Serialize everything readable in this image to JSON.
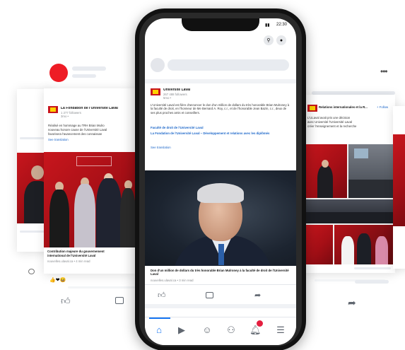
{
  "left_post": {
    "page_name": "La Fondation de l'Université Laval",
    "followers": "1 277 followers",
    "time": "3mo • ",
    "body_line1": "Réalisé en hommage au TRH Brian Mulro",
    "body_line2": "nouveau honore cause de l'Université Laval",
    "body_line3": "favorisera l'avancement des connaissan",
    "see_translation": "See translation",
    "caption_line1": "Contribution majeure du gouvernement",
    "caption_line2": "international de l'Université Laval",
    "caption_meta": "nouvelles.ulaval.ca • 4 min read",
    "reactions": "👍❤😆"
  },
  "right_post": {
    "page_name": "Relations internationales et la R...",
    "follow_label": "+ Follow",
    "body_line1": "L'ULaval avait pris une décision",
    "body_line2": "avec Université l'Université Laval",
    "body_line3": "créer l'enseignement et la recherche"
  },
  "phone": {
    "status_time": "22:30",
    "post": {
      "page_name": "Université Laval",
      "followers": "267 488 followers",
      "time": "5mo • ",
      "body": "L'Université Laval est fière d'annoncer le don d'un million de dollars du très honorable Brian Mulroney à la faculté de droit, en l'honneur de Me Bernard A. Roy, c.r., et de l'honorable Jean Bazin, c.r., deux de ses plus proches amis et conseillers.",
      "link1": "Faculté de droit de l'Université Laval",
      "link2": "La Fondation de l'Université Laval – Développement et relations avec les diplômés",
      "see_translation": "See translation",
      "caption": "Don d'un million de dollars du très honorable Brian Mulroney à la faculté de droit de l'Université Laval",
      "caption_meta": "nouvelles.ulaval.ca • 3 min read"
    }
  },
  "colors": {
    "accent": "#1877f2",
    "red": "#c8161d",
    "notification": "#e41e3f"
  }
}
